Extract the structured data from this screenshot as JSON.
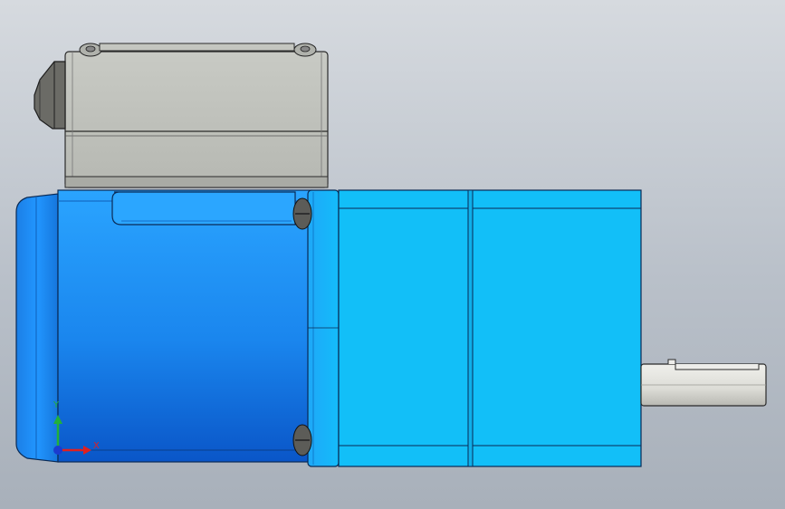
{
  "view": {
    "background_top": "#d6dadf",
    "background_bottom": "#a8b0ba"
  },
  "model": {
    "motor_color": "#1f8ff0",
    "gearbox_color": "#12bff8",
    "terminal_box_color": "#c4c6c0",
    "shaft_color": "#dcdcd8"
  },
  "triad": {
    "x_label": "X",
    "y_label": "Y",
    "x_color": "#e02020",
    "y_color": "#22b03a",
    "z_color": "#1a3cd0"
  }
}
